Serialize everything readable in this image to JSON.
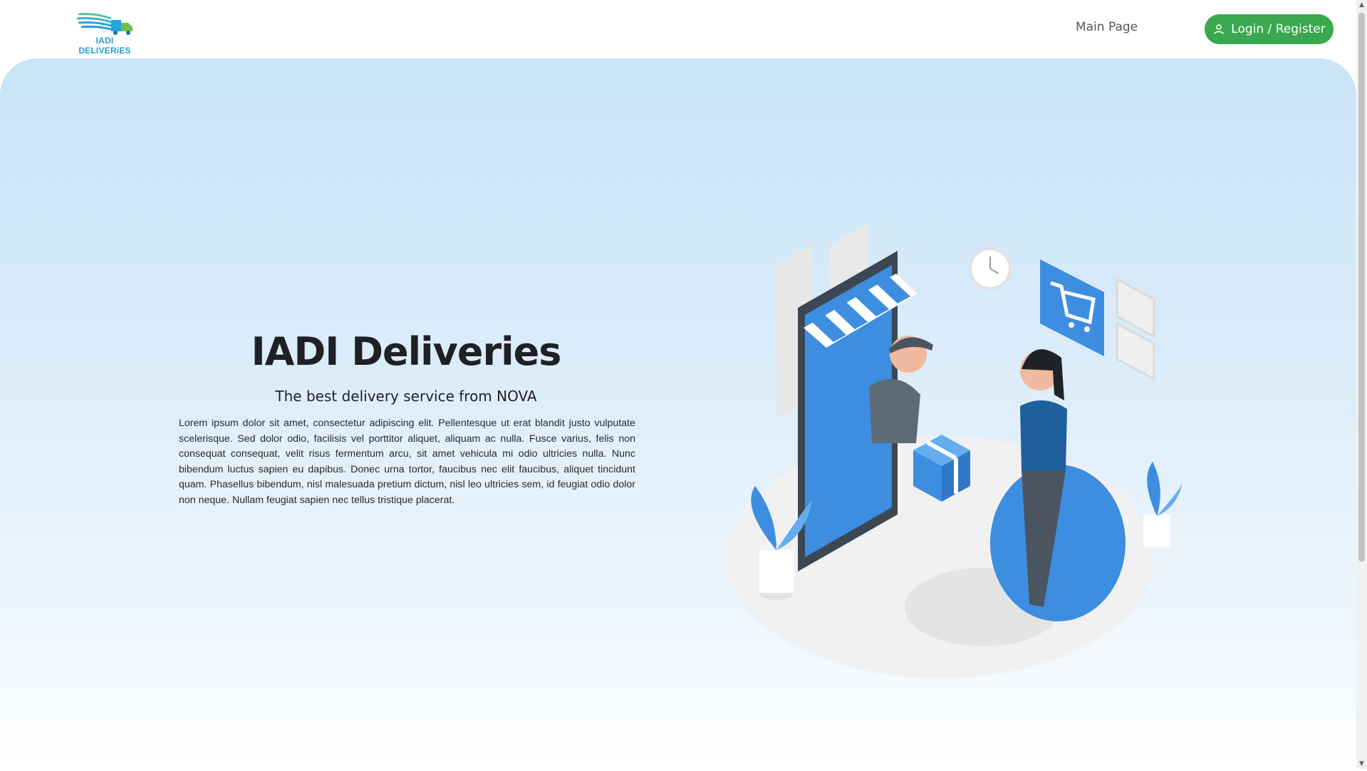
{
  "header": {
    "logo_text": "IADI DELIVERiES",
    "nav": {
      "main_page": "Main Page"
    },
    "login_button": "Login / Register"
  },
  "hero": {
    "title": "IADI Deliveries",
    "subtitle": "The best delivery service from NOVA",
    "body": "Lorem ipsum dolor sit amet, consectetur adipiscing elit. Pellentesque ut erat blandit justo vulputate scelerisque. Sed dolor odio, facilisis vel porttitor aliquet, aliquam ac nulla. Fusce varius, felis non consequat consequat, velit risus fermentum arcu, sit amet vehicula mi odio ultricies nulla. Nunc bibendum luctus sapien eu dapibus. Donec urna tortor, faucibus nec elit faucibus, aliquet tincidunt quam. Phasellus bibendum, nisl malesuada pretium dictum, nisl leo ultricies sem, id feugiat odio dolor non neque. Nullam feugiat sapien nec tellus tristique placerat."
  },
  "colors": {
    "accent_green": "#3aa84f",
    "brand_blue": "#1e9fd8",
    "illustration_blue": "#3d8ee0"
  },
  "icons": {
    "logo": "delivery-truck-logo",
    "login": "user-icon"
  }
}
